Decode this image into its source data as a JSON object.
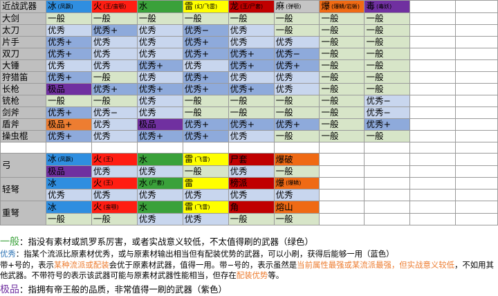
{
  "colors": {
    "ice": "#2f8ee0",
    "fire": "#ff1d12",
    "water": "#3aa13a",
    "thunder": "#ffff00",
    "dragon": "#c00000",
    "paralysis": "#c5c5c5",
    "blast": "#ef6a14",
    "poison": "#7030a0",
    "grade_normal": "#d7e5c8",
    "grade_good": "#8eaadb",
    "grade_good_light": "#c8d6ee",
    "grade_best": "#7030a0",
    "grade_best_alt": "#ed7d31"
  },
  "melee_header": {
    "label": "近战武器",
    "cells": [
      {
        "main": "冰",
        "sub": "(凤飘)",
        "cls": "h-ice"
      },
      {
        "main": "火",
        "sub": "(王/蛮颚)",
        "cls": "h-fire"
      },
      {
        "main": "水",
        "sub": "",
        "cls": "h-water"
      },
      {
        "main": "雷",
        "sub": "(幻/飞雷)",
        "cls": "h-thunder"
      },
      {
        "main": "龙",
        "sub": "(王/尸套)",
        "cls": "h-dragon"
      },
      {
        "main": "麻",
        "sub": "(弹颚)",
        "cls": "h-para"
      },
      {
        "main": "爆",
        "sub": "(爆鳞/岩蜥)",
        "cls": "h-blast"
      },
      {
        "main": "毒",
        "sub": "(毒妖)",
        "cls": "h-poison"
      }
    ]
  },
  "melee_rows": [
    {
      "name": "大剑",
      "cells": [
        [
          "一般",
          "g-green"
        ],
        [
          "一般",
          "g-green"
        ],
        [
          "一般",
          "g-green"
        ],
        [
          "一般",
          "g-green"
        ],
        [
          "一般",
          "g-green"
        ],
        [
          "一般",
          "g-green"
        ],
        [
          "一般",
          "g-green"
        ],
        [
          "一般",
          "g-green"
        ]
      ]
    },
    {
      "name": "太刀",
      "cells": [
        [
          "优秀",
          "g-lblue"
        ],
        [
          "优秀+",
          "g-blue"
        ],
        [
          "优秀",
          "g-lblue"
        ],
        [
          "优秀−",
          "g-blue"
        ],
        [
          "优秀",
          "g-lblue"
        ],
        [
          "一般",
          "g-green"
        ],
        [
          "一般",
          "g-green"
        ],
        [
          "一般",
          "g-green"
        ]
      ]
    },
    {
      "name": "片手",
      "cells": [
        [
          "优秀+",
          "g-blue"
        ],
        [
          "优秀",
          "g-lblue"
        ],
        [
          "优秀",
          "g-lblue"
        ],
        [
          "优秀+",
          "g-blue"
        ],
        [
          "优秀",
          "g-lblue"
        ],
        [
          "优秀",
          "g-lblue"
        ],
        [
          "一般",
          "g-green"
        ],
        [
          "一般",
          "g-green"
        ]
      ]
    },
    {
      "name": "双刀",
      "cells": [
        [
          "优秀+",
          "g-blue"
        ],
        [
          "优秀",
          "g-lblue"
        ],
        [
          "优秀",
          "g-lblue"
        ],
        [
          "优秀+",
          "g-blue"
        ],
        [
          "优秀+",
          "g-blue"
        ],
        [
          "优秀−",
          "g-blue"
        ],
        [
          "一般",
          "g-green"
        ],
        [
          "一般",
          "g-green"
        ]
      ]
    },
    {
      "name": "大锤",
      "cells": [
        [
          "优秀",
          "g-lblue"
        ],
        [
          "优秀",
          "g-lblue"
        ],
        [
          "优秀+",
          "g-blue"
        ],
        [
          "优秀",
          "g-lblue"
        ],
        [
          "优秀+",
          "g-blue"
        ],
        [
          "优秀+",
          "g-blue"
        ],
        [
          "一般",
          "g-green"
        ],
        [
          "一般",
          "g-green"
        ]
      ]
    },
    {
      "name": "狩猎笛",
      "cells": [
        [
          "优秀+",
          "g-blue"
        ],
        [
          "一般",
          "g-green"
        ],
        [
          "优秀",
          "g-lblue"
        ],
        [
          "优秀+",
          "g-blue"
        ],
        [
          "优秀",
          "g-lblue"
        ],
        [
          "优秀",
          "g-lblue"
        ],
        [
          "一般",
          "g-green"
        ],
        [
          "一般",
          "g-green"
        ]
      ]
    },
    {
      "name": "长枪",
      "cells": [
        [
          "极品",
          "g-purple"
        ],
        [
          "优秀+",
          "g-blue"
        ],
        [
          "优秀+",
          "g-blue"
        ],
        [
          "优秀+",
          "g-blue"
        ],
        [
          "优秀+",
          "g-blue"
        ],
        [
          "优秀",
          "g-lblue"
        ],
        [
          "一般",
          "g-green"
        ],
        [
          "一般",
          "g-green"
        ]
      ]
    },
    {
      "name": "铳枪",
      "cells": [
        [
          "一般",
          "g-green"
        ],
        [
          "一般",
          "g-green"
        ],
        [
          "优秀",
          "g-lblue"
        ],
        [
          "一般",
          "g-green"
        ],
        [
          "一般",
          "g-green"
        ],
        [
          "一般",
          "g-green"
        ],
        [
          "一般",
          "g-green"
        ],
        [
          "优秀−",
          "g-lblue"
        ]
      ]
    },
    {
      "name": "剑斧",
      "cells": [
        [
          "优秀+",
          "g-blue"
        ],
        [
          "优秀−",
          "g-lblue"
        ],
        [
          "优秀",
          "g-lblue"
        ],
        [
          "一般",
          "g-green"
        ],
        [
          "一般",
          "g-green"
        ],
        [
          "一般",
          "g-green"
        ],
        [
          "一般",
          "g-green"
        ],
        [
          "优秀−",
          "g-lblue"
        ]
      ]
    },
    {
      "name": "盾斧",
      "cells": [
        [
          "极品+",
          "g-orange"
        ],
        [
          "优秀",
          "g-lblue"
        ],
        [
          "极品",
          "g-purple"
        ],
        [
          "优秀+",
          "g-blue"
        ],
        [
          "优秀+",
          "g-blue"
        ],
        [
          "优秀+",
          "g-blue"
        ],
        [
          "一般",
          "g-green"
        ],
        [
          "优秀+",
          "g-blue"
        ]
      ]
    },
    {
      "name": "操虫棍",
      "cells": [
        [
          "优秀+",
          "g-blue"
        ],
        [
          "优秀",
          "g-lblue"
        ],
        [
          "优秀+",
          "g-blue"
        ],
        [
          "优秀+",
          "g-blue"
        ],
        [
          "优秀",
          "g-lblue"
        ],
        [
          "一般",
          "g-green"
        ],
        [
          "一般",
          "g-green"
        ],
        [
          "一般",
          "g-green"
        ]
      ]
    }
  ],
  "ranged_groups": [
    {
      "name": "弓",
      "elements": [
        {
          "main": "冰",
          "sub": "(凤飘)",
          "cls": "h-ice"
        },
        {
          "main": "火",
          "sub": "(王)",
          "cls": "h-fire"
        },
        {
          "main": "水",
          "sub": "",
          "cls": "h-water"
        },
        {
          "main": "雷",
          "sub": "(飞雷)",
          "cls": "h-thunder"
        },
        {
          "main": "尸套",
          "sub": "",
          "cls": "h-dragon"
        },
        {
          "main": "爆破",
          "sub": "",
          "cls": "h-blast"
        }
      ],
      "grades": [
        [
          "极品",
          "g-purple"
        ],
        [
          "优秀",
          "g-lblue"
        ],
        [
          "优秀",
          "g-lblue"
        ],
        [
          "一般",
          "g-green"
        ],
        [
          "优秀",
          "g-lblue"
        ],
        [
          "一般",
          "g-green"
        ]
      ]
    },
    {
      "name": "轻弩",
      "elements": [
        {
          "main": "冰",
          "sub": "",
          "cls": "h-ice"
        },
        {
          "main": "火",
          "sub": "(王)",
          "cls": "h-fire"
        },
        {
          "main": "水",
          "sub": "(尸套)",
          "cls": "h-green"
        },
        {
          "main": "雷",
          "sub": "",
          "cls": "h-thunder"
        },
        {
          "main": "榜派",
          "sub": "",
          "cls": "h-dragon"
        },
        {
          "main": "爆",
          "sub": "(爆鳞)",
          "cls": "h-blast"
        }
      ],
      "grades": [
        [
          "优秀",
          "g-lblue"
        ],
        [
          "优秀",
          "g-lblue"
        ],
        [
          "优秀",
          "g-lblue"
        ],
        [
          "优秀",
          "g-lblue"
        ],
        [
          "优秀",
          "g-lblue"
        ],
        [
          "优秀",
          "g-lblue"
        ]
      ]
    },
    {
      "name": "重弩",
      "elements": [
        {
          "main": "冰",
          "sub": "",
          "cls": "h-ice"
        },
        {
          "main": "火",
          "sub": "(蛮颚)",
          "cls": "h-fire"
        },
        {
          "main": "水",
          "sub": "",
          "cls": "h-water"
        },
        {
          "main": "雷",
          "sub": "(飞雷)",
          "cls": "h-thunder"
        },
        {
          "main": "角",
          "sub": "",
          "cls": "h-dragon"
        },
        {
          "main": "熔山",
          "sub": "",
          "cls": "h-blast"
        }
      ],
      "grades": [
        [
          "一般",
          "g-green"
        ],
        [
          "一般",
          "g-green"
        ],
        [
          "优秀",
          "g-lblue"
        ],
        [
          "优秀",
          "g-lblue"
        ],
        [
          "一般",
          "g-green"
        ],
        [
          "一般",
          "g-green"
        ]
      ]
    }
  ],
  "legend": {
    "normal_tag": "一般",
    "normal_text": "：指没有素材或凯罗系厉害，或者实战意义较低，不太值得刷的武器（绿色）",
    "good_tag": "优秀",
    "good_text_1": "：指某个流派比原素材优秀，或与原素材输出相当但有配装优势的武器，可以小刷，获得后能够一用（蓝色）",
    "plus_text_1": "带+号的，表示",
    "plus_hl_1": "某种流派或配装",
    "plus_text_2": "会优于原素材武器，值得一用。带−号的，表示虽然是",
    "plus_hl_2": "当前属性最强或某流派最强，但实战意义较低",
    "plus_text_3": "，不如用其他武器。不带符号的表示该武器可能与原素材武器性能相当，但存在",
    "plus_hl_3": "配装优势",
    "plus_text_4": "等。",
    "best_tag": "极品",
    "best_text": "：指拥有帝王般的品质，非常值得一刷的武器（紫色）"
  }
}
